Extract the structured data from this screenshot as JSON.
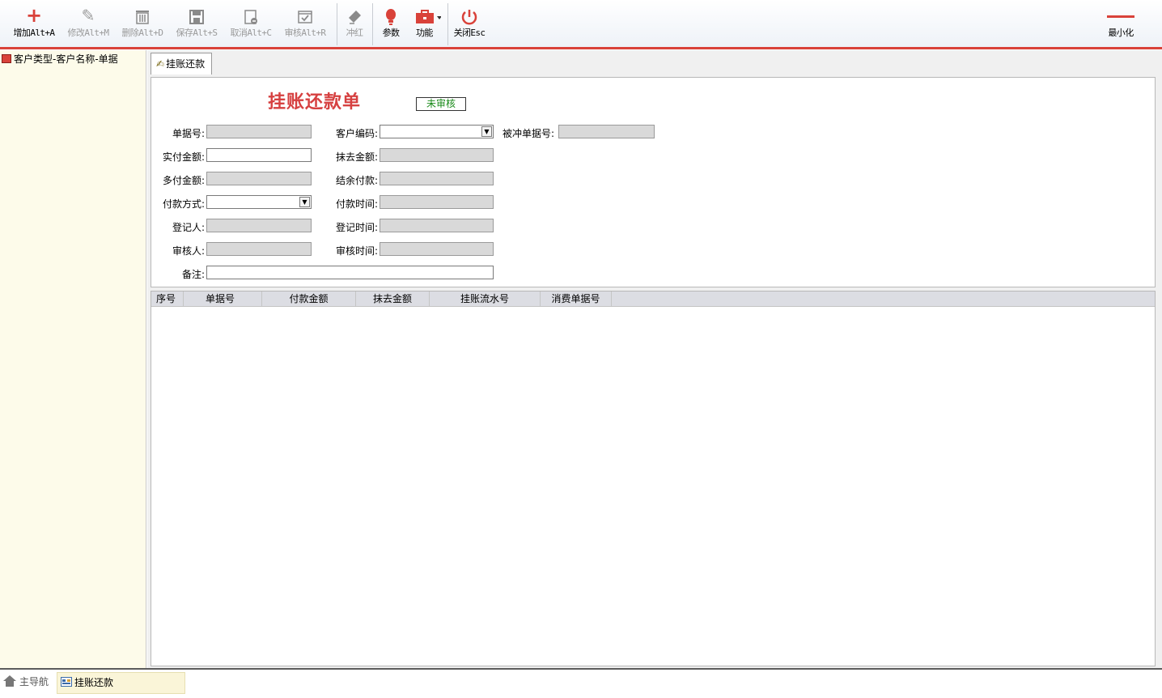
{
  "toolbar": {
    "add": {
      "label": "增加Alt+A",
      "icon": "plus-icon"
    },
    "edit": {
      "label": "修改Alt+M",
      "icon": "pencil-icon"
    },
    "delete": {
      "label": "删除Alt+D",
      "icon": "trash-icon"
    },
    "save": {
      "label": "保存Alt+S",
      "icon": "floppy-icon"
    },
    "cancel": {
      "label": "取消Alt+C",
      "icon": "cancel-doc-icon"
    },
    "audit": {
      "label": "审核Alt+R",
      "icon": "check-doc-icon"
    },
    "reverse": {
      "label": "冲红",
      "icon": "eraser-icon"
    },
    "params": {
      "label": "参数",
      "icon": "bulb-icon"
    },
    "functions": {
      "label": "功能",
      "icon": "toolbox-icon"
    },
    "close": {
      "label": "关闭Esc",
      "icon": "power-icon"
    },
    "minimize": {
      "label": "最小化",
      "icon": "minimize-icon"
    }
  },
  "tree": {
    "root_label": "客户类型-客户名称-单据"
  },
  "tab": {
    "label": "挂账还款"
  },
  "form": {
    "title": "挂账还款单",
    "status": "未审核",
    "fields": {
      "doc_no": {
        "label": "单据号:",
        "value": ""
      },
      "customer_code": {
        "label": "客户编码:",
        "value": ""
      },
      "reversed_doc_no": {
        "label": "被冲单据号:",
        "value": ""
      },
      "paid_amount": {
        "label": "实付金额:",
        "value": ""
      },
      "write_off_amount": {
        "label": "抹去金额:",
        "value": ""
      },
      "overpaid_amount": {
        "label": "多付金额:",
        "value": ""
      },
      "balance_payment": {
        "label": "结余付款:",
        "value": ""
      },
      "payment_method": {
        "label": "付款方式:",
        "value": ""
      },
      "payment_time": {
        "label": "付款时间:",
        "value": ""
      },
      "registrar": {
        "label": "登记人:",
        "value": ""
      },
      "register_time": {
        "label": "登记时间:",
        "value": ""
      },
      "auditor": {
        "label": "审核人:",
        "value": ""
      },
      "audit_time": {
        "label": "审核时间:",
        "value": ""
      },
      "remark": {
        "label": "备注:",
        "value": ""
      }
    }
  },
  "grid": {
    "columns": [
      "序号",
      "单据号",
      "付款金额",
      "抹去金额",
      "挂账流水号",
      "消费单据号"
    ],
    "rows": []
  },
  "bottom": {
    "home_label": "主导航",
    "active_label": "挂账还款"
  },
  "colors": {
    "accent": "#d9423a",
    "title": "#d64040",
    "status": "#1a8a1a",
    "tree_bg": "#fdfbea"
  }
}
